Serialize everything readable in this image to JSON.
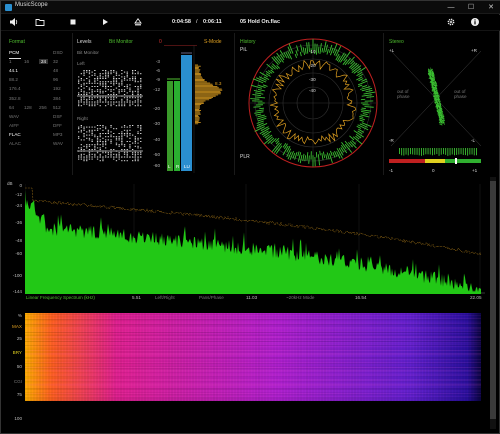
{
  "window": {
    "title": "MusicScope",
    "minimize": "—",
    "maximize": "☐",
    "close": "✕"
  },
  "toolbar": {
    "time_elapsed": "0:04:58",
    "time_sep": "/",
    "time_total": "0:06:11",
    "file_name": "05 Hold On.flac"
  },
  "format": {
    "title": "Format",
    "rows": [
      [
        "PCM",
        "",
        "",
        "DSD"
      ],
      [
        "1",
        "16",
        "24",
        "32"
      ],
      [
        "44.1",
        "",
        "",
        "48"
      ],
      [
        "88.2",
        "",
        "",
        "96"
      ],
      [
        "176.4",
        "",
        "",
        "192"
      ],
      [
        "352.8",
        "",
        "",
        "384"
      ],
      [
        "64",
        "128",
        "256",
        "512"
      ],
      [
        "WAV",
        "",
        "",
        "DSF"
      ],
      [
        "AIFF",
        "",
        "",
        "DFF"
      ],
      [
        "FLAC",
        "",
        "",
        "MP3"
      ],
      [
        "ALAC",
        "",
        "",
        "WAV"
      ]
    ]
  },
  "levels": {
    "title": "Levels",
    "bit_monitor": "Bit Monitor",
    "bit_monitor_left": "Bit Monitor",
    "left": "Left",
    "right": "Right",
    "scale": [
      "0",
      "-3",
      "-6",
      "-9",
      "-12",
      "-20",
      "-30",
      "-40",
      "-50",
      "-60"
    ],
    "peak_value": "8.3",
    "channel_labels": [
      "L",
      "R",
      "LU"
    ],
    "s_mode": "S-Mode"
  },
  "history": {
    "title": "History",
    "pl": "PiL",
    "plr": "PLR",
    "rings": [
      "-10",
      "-20",
      "-30",
      "-40"
    ]
  },
  "stereo": {
    "title": "Stereo",
    "top_left": "+L",
    "top_right": "+R",
    "bottom_left": "-R",
    "bottom_right": "-L",
    "out_of_phase_left": "out of phase",
    "out_of_phase_right": "out of phase",
    "corr_left": "-1",
    "corr_mid": "0",
    "corr_right": "+1"
  },
  "spectrum": {
    "y_unit": "dB",
    "y_ticks": [
      "0",
      "-12",
      "-24",
      "-36",
      "-48",
      "-60",
      "-100",
      "-144"
    ],
    "x_ticks": [
      "5.51",
      "11.03",
      "16.54",
      "22.05"
    ],
    "label": "Linear Frequency Spectrum (kHz)",
    "mode_labels": [
      "Left/Right",
      "Pans/Phase",
      "~20kHz Mode"
    ]
  },
  "spectrogram": {
    "y_ticks": [
      "%",
      "MAX",
      "25",
      "BRY",
      "50",
      "CGI",
      "75",
      "100"
    ]
  },
  "colors": {
    "accent_green": "#4fbf2f",
    "spectrum_fill": "#22c816",
    "peak_line": "#e0a020",
    "meter_blue": "#2a8fd0"
  }
}
